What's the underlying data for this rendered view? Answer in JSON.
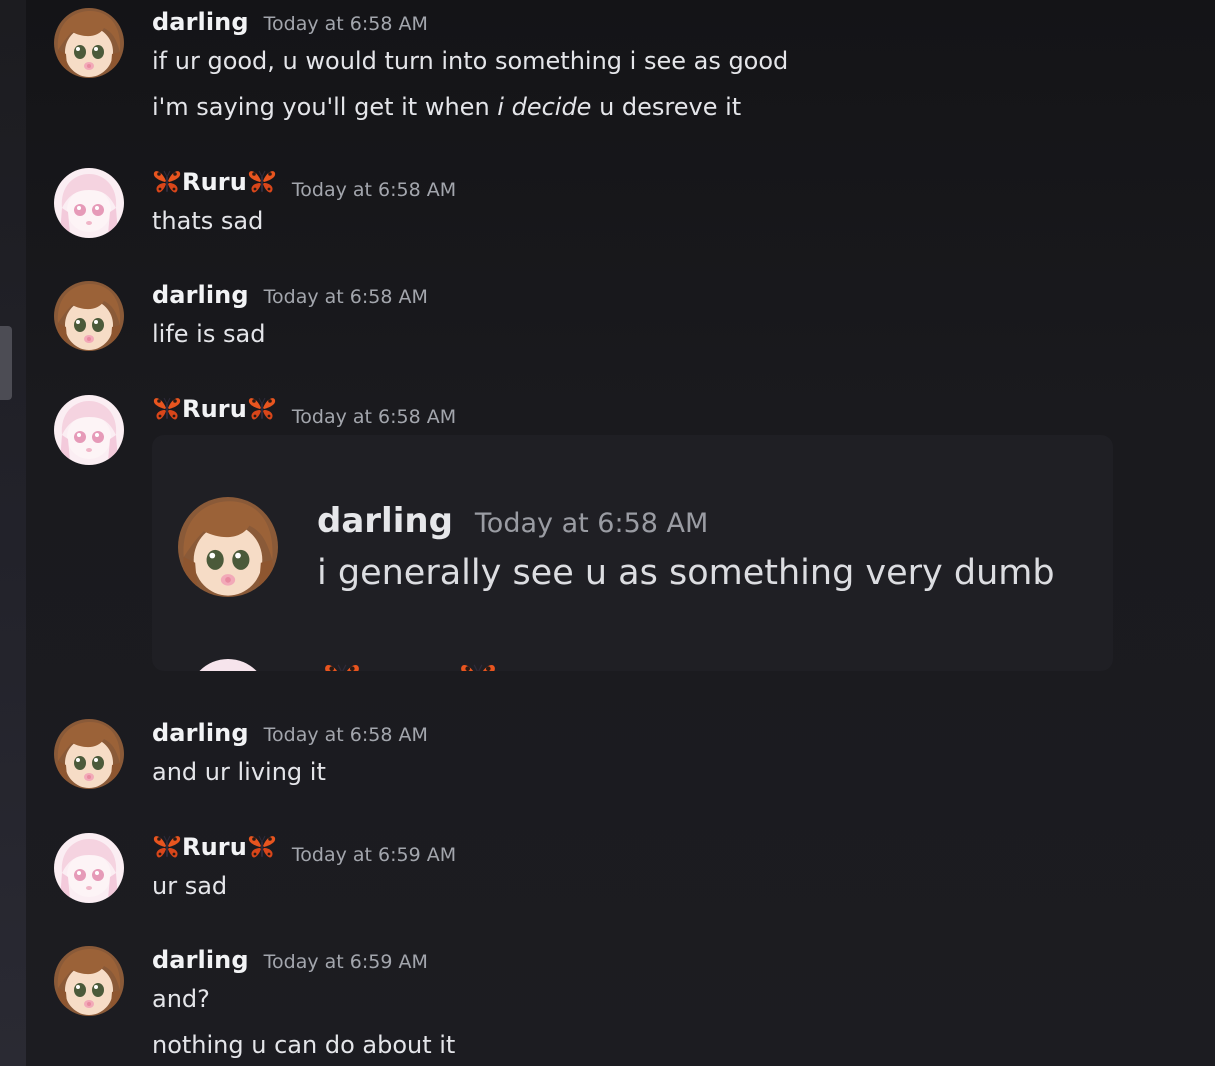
{
  "colors": {
    "background": "#1a1a1e",
    "username": "#f2f3f5",
    "timestamp": "#a3a6ad",
    "message_text": "#e4e5e9",
    "embed_background": "#1f1f24",
    "scroll_thumb": "#4c4c54"
  },
  "icons": {
    "butterfly": "butterfly-emoji",
    "avatar_darling": "anime-girl-brown-hair-avatar",
    "avatar_ruru": "anime-girl-pink-avatar"
  },
  "messages": [
    {
      "author": "darling",
      "timestamp": "Today at 6:58 AM",
      "lines": [
        "if ur good, u would turn into something i see as good",
        {
          "before": "i'm saying you'll get it when ",
          "emphasis": "i decide",
          "after": " u desreve it"
        }
      ]
    },
    {
      "author": "Ruru",
      "timestamp": "Today at 6:58 AM",
      "lines": [
        "thats sad"
      ]
    },
    {
      "author": "darling",
      "timestamp": "Today at 6:58 AM",
      "lines": [
        "life is sad"
      ]
    },
    {
      "author": "Ruru",
      "timestamp": "Today at 6:58 AM",
      "embed": {
        "author": "darling",
        "timestamp": "Today at 6:58 AM",
        "text": "i generally see u as something very dumb"
      }
    },
    {
      "author": "darling",
      "timestamp": "Today at 6:58 AM",
      "lines": [
        "and ur living it"
      ]
    },
    {
      "author": "Ruru",
      "timestamp": "Today at 6:59 AM",
      "lines": [
        "ur sad"
      ]
    },
    {
      "author": "darling",
      "timestamp": "Today at 6:59 AM",
      "lines": [
        "and?",
        "nothing u can do about it"
      ]
    }
  ]
}
